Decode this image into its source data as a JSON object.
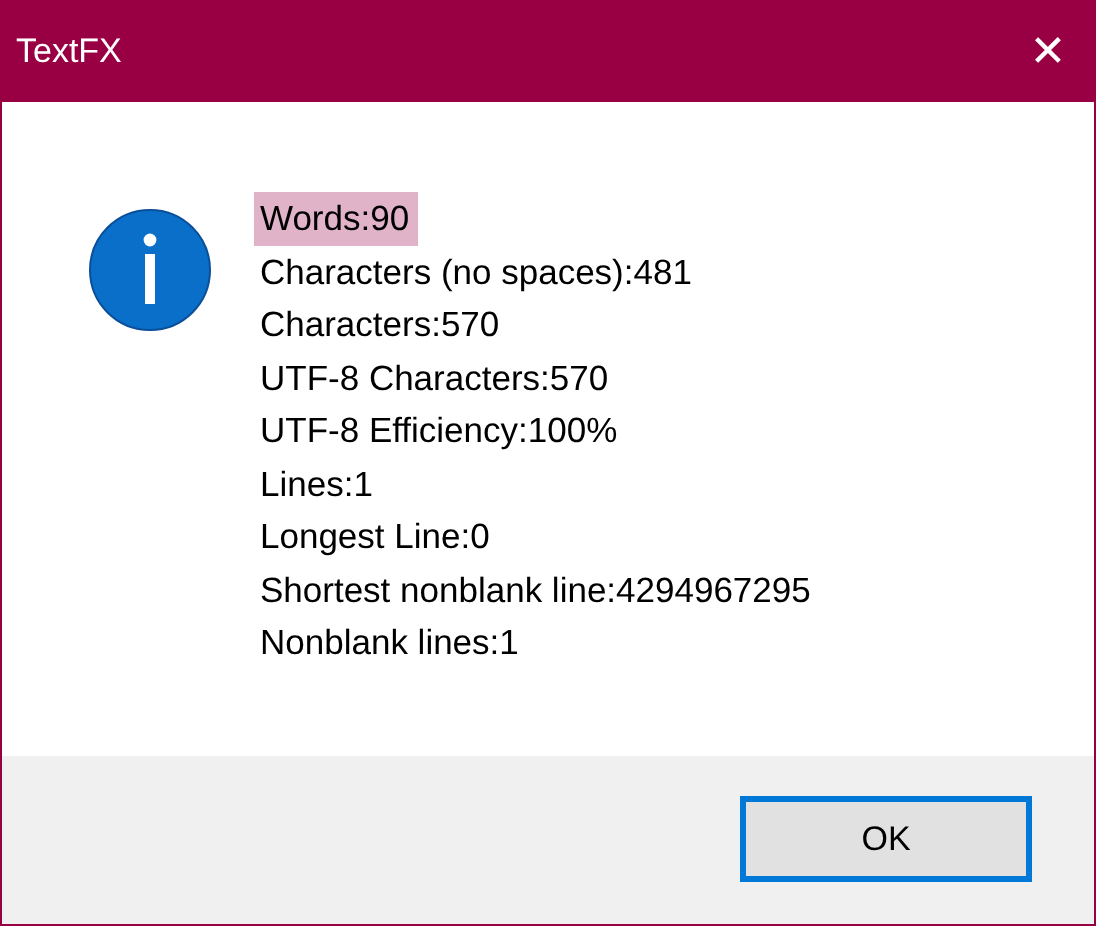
{
  "window": {
    "title": "TextFX",
    "close": "✕"
  },
  "message": {
    "lines": [
      {
        "text": "Words:90",
        "selected": true
      },
      {
        "text": "Characters (no spaces):481",
        "selected": false
      },
      {
        "text": "Characters:570",
        "selected": false
      },
      {
        "text": "UTF-8 Characters:570",
        "selected": false
      },
      {
        "text": "UTF-8 Efficiency:100%",
        "selected": false
      },
      {
        "text": "Lines:1",
        "selected": false
      },
      {
        "text": "Longest Line:0",
        "selected": false
      },
      {
        "text": "Shortest nonblank line:4294967295",
        "selected": false
      },
      {
        "text": "Nonblank lines:1",
        "selected": false
      }
    ]
  },
  "buttons": [
    {
      "label": "OK",
      "focused": true
    }
  ]
}
